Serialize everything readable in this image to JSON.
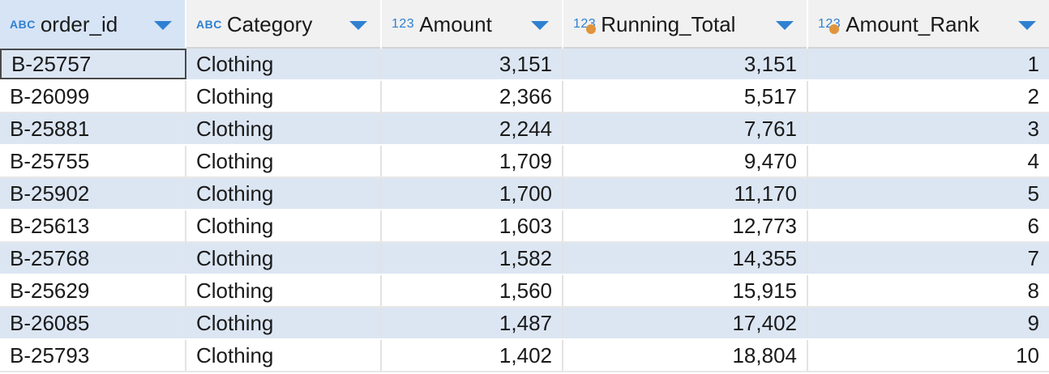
{
  "columns": [
    {
      "label": "order_id",
      "type": "ABC"
    },
    {
      "label": "Category",
      "type": "ABC"
    },
    {
      "label": "Amount",
      "type": "123"
    },
    {
      "label": "Running_Total",
      "type": "123"
    },
    {
      "label": "Amount_Rank",
      "type": "123"
    }
  ],
  "rows": [
    {
      "order_id": "B-25757",
      "category": "Clothing",
      "amount": "3,151",
      "running_total": "3,151",
      "rank": "1"
    },
    {
      "order_id": "B-26099",
      "category": "Clothing",
      "amount": "2,366",
      "running_total": "5,517",
      "rank": "2"
    },
    {
      "order_id": "B-25881",
      "category": "Clothing",
      "amount": "2,244",
      "running_total": "7,761",
      "rank": "3"
    },
    {
      "order_id": "B-25755",
      "category": "Clothing",
      "amount": "1,709",
      "running_total": "9,470",
      "rank": "4"
    },
    {
      "order_id": "B-25902",
      "category": "Clothing",
      "amount": "1,700",
      "running_total": "11,170",
      "rank": "5"
    },
    {
      "order_id": "B-25613",
      "category": "Clothing",
      "amount": "1,603",
      "running_total": "12,773",
      "rank": "6"
    },
    {
      "order_id": "B-25768",
      "category": "Clothing",
      "amount": "1,582",
      "running_total": "14,355",
      "rank": "7"
    },
    {
      "order_id": "B-25629",
      "category": "Clothing",
      "amount": "1,560",
      "running_total": "15,915",
      "rank": "8"
    },
    {
      "order_id": "B-26085",
      "category": "Clothing",
      "amount": "1,487",
      "running_total": "17,402",
      "rank": "9"
    },
    {
      "order_id": "B-25793",
      "category": "Clothing",
      "amount": "1,402",
      "running_total": "18,804",
      "rank": "10"
    }
  ],
  "colors": {
    "accent": "#2f80d1",
    "row_alt": "#dce6f3",
    "header_selected": "#d6e4f6",
    "calc_dot": "#e0943c"
  }
}
